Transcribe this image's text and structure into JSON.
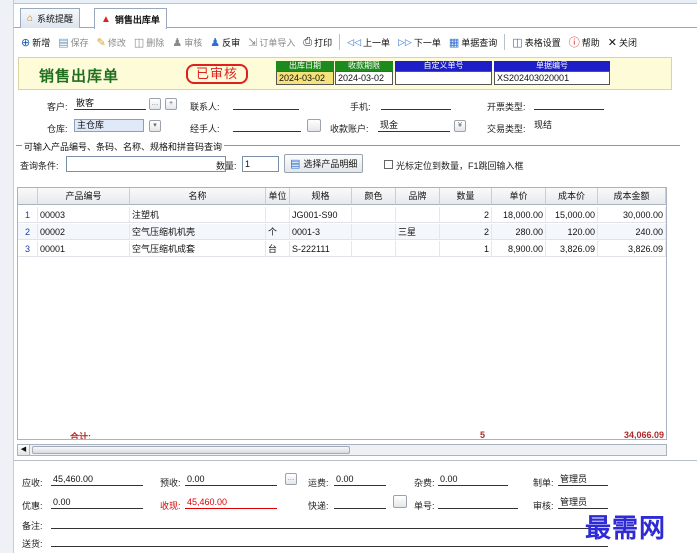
{
  "tabs": [
    {
      "label": "系统提醒",
      "icon": "home-icon"
    },
    {
      "label": "销售出库单",
      "icon": "basket-icon"
    }
  ],
  "toolbar": {
    "new": "新增",
    "save": "保存",
    "edit": "修改",
    "delete": "删除",
    "audit": "审核",
    "unaudit": "反审",
    "import": "订单导入",
    "print": "打印",
    "prev": "上一单",
    "next": "下一单",
    "query": "单据查询",
    "table_settings": "表格设置",
    "help": "帮助",
    "close": "关闭"
  },
  "header": {
    "title": "销售出库单",
    "stamp": "已审核",
    "out_date_label": "出库日期",
    "out_date": "2024-03-02",
    "collect_label": "收款期限",
    "collect_date": "2024-03-02",
    "custom_no_label": "自定义单号",
    "custom_no": "",
    "doc_no_label": "单据编号",
    "doc_no": "XS202403020001",
    "accent": "#1d8a1d",
    "doc_accent": "#1e1ec8"
  },
  "form": {
    "customer_label": "客户:",
    "customer": "散客",
    "contact_label": "联系人:",
    "contact": "",
    "phone_label": "手机:",
    "phone": "",
    "invoice_label": "开票类型:",
    "invoice": "",
    "warehouse_label": "仓库:",
    "warehouse": "主仓库",
    "handler_label": "经手人:",
    "handler": "",
    "account_label": "收款账户:",
    "account": "现金",
    "trade_label": "交易类型:",
    "trade": "现结"
  },
  "query": {
    "group_title": "可输入产品编号、条码、名称、规格和拼音码查询",
    "cond_label": "查询条件:",
    "cond_value": "",
    "qty_label": "数量:",
    "qty_value": "1",
    "select_btn": "选择产品明细",
    "locate_text": "光标定位到数量，F1跳回输入框"
  },
  "grid": {
    "columns": [
      "产品编号",
      "名称",
      "单位",
      "规格",
      "颜色",
      "品牌",
      "数量",
      "单价",
      "成本价",
      "成本金额"
    ],
    "rows": [
      {
        "n": "1",
        "code": "00003",
        "name": "注塑机",
        "unit": "",
        "spec": "JG001-S90",
        "color": "",
        "brand": "",
        "qty": "2",
        "price": "18,000.00",
        "cost": "15,000.00",
        "amount": "30,000.00"
      },
      {
        "n": "2",
        "code": "00002",
        "name": "空气压缩机机壳",
        "unit": "个",
        "spec": "0001-3",
        "color": "",
        "brand": "三星",
        "qty": "2",
        "price": "280.00",
        "cost": "120.00",
        "amount": "240.00"
      },
      {
        "n": "3",
        "code": "00001",
        "name": "空气压缩机成套",
        "unit": "台",
        "spec": "S-222111",
        "color": "",
        "brand": "",
        "qty": "1",
        "price": "8,900.00",
        "cost": "3,826.09",
        "amount": "3,826.09"
      }
    ],
    "total_label": "合计:",
    "total_qty": "5",
    "total_amount": "34,066.09"
  },
  "footer": {
    "receivable_label": "应收:",
    "receivable": "45,460.00",
    "prepaid_label": "预收:",
    "prepaid": "0.00",
    "freight_label": "运费:",
    "freight": "0.00",
    "misc_label": "杂费:",
    "misc": "0.00",
    "maker_label": "制单:",
    "maker": "管理员",
    "discount_label": "优惠:",
    "discount": "0.00",
    "received_label": "收现:",
    "received": "45,460.00",
    "express_label": "快递:",
    "express": "",
    "order_no_label": "单号:",
    "order_no": "",
    "auditor_label": "审核:",
    "auditor": "管理员",
    "remark_label": "备注:",
    "remark": "",
    "delivery_label": "送货:",
    "delivery": ""
  },
  "watermark": "最需网"
}
